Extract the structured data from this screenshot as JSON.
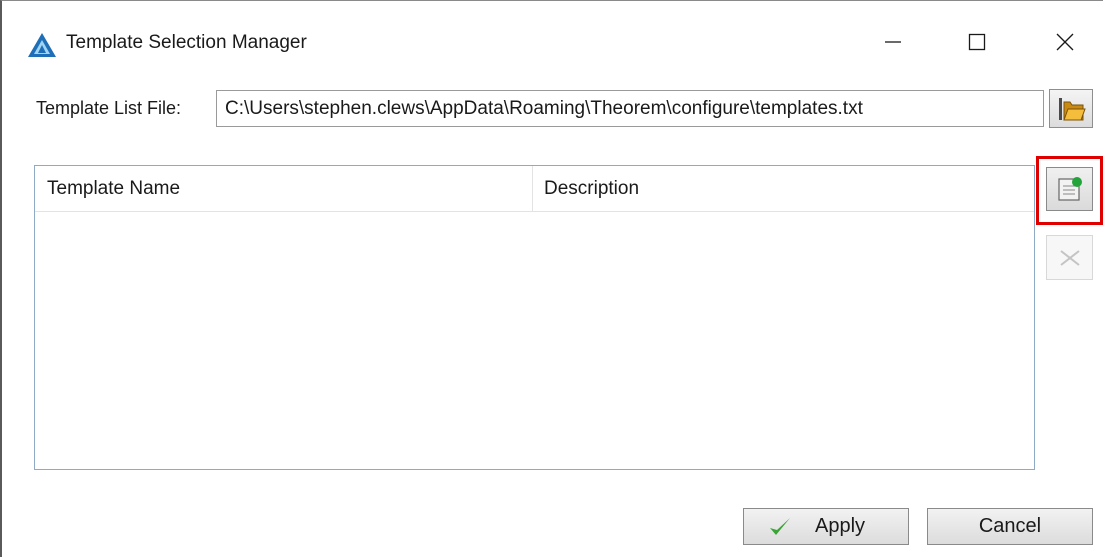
{
  "window": {
    "title": "Template Selection Manager",
    "icon": "theorem-logo-icon",
    "controls": [
      "minimize-icon",
      "maximize-icon",
      "close-icon"
    ]
  },
  "template_file": {
    "label": "Template List File:",
    "value": "C:\\Users\\stephen.clews\\AppData\\Roaming\\Theorem\\configure\\templates.txt",
    "browse_icon": "open-folder-icon"
  },
  "list": {
    "columns": [
      "Template Name",
      "Description"
    ],
    "rows": []
  },
  "side_buttons": {
    "add_icon": "add-template-icon",
    "delete_icon": "delete-x-icon",
    "highlight_color": "#e00000"
  },
  "buttons": {
    "apply": "Apply",
    "cancel": "Cancel",
    "apply_icon": "checkmark-icon",
    "accent_check_color": "#3aa535"
  }
}
